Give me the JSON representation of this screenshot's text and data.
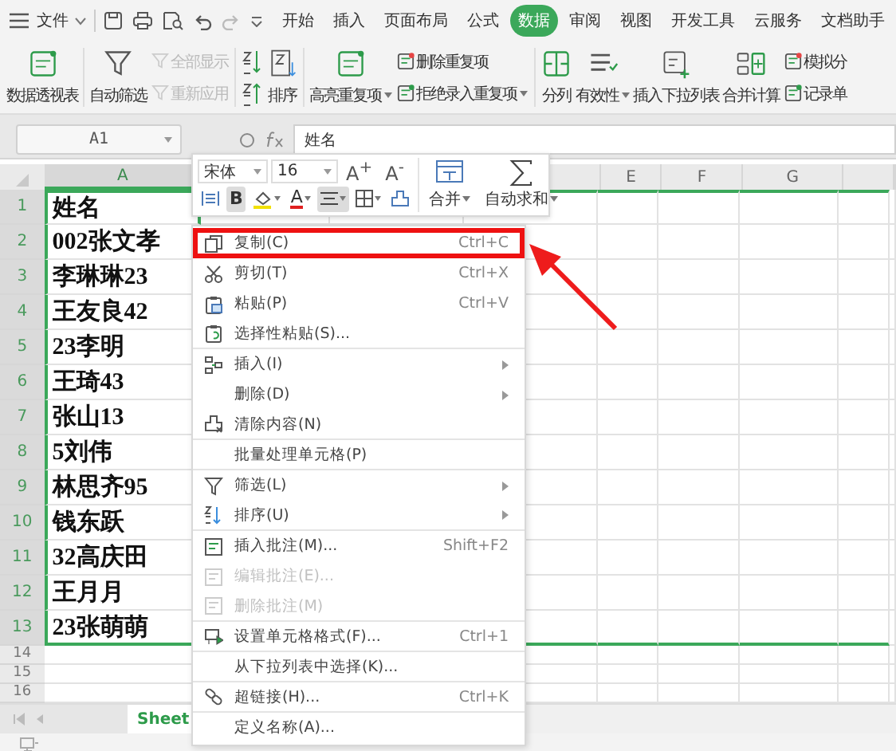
{
  "menu_bar": {
    "file_label": "文件",
    "tabs": [
      {
        "label": "开始",
        "selected": false
      },
      {
        "label": "插入",
        "selected": false
      },
      {
        "label": "页面布局",
        "selected": false
      },
      {
        "label": "公式",
        "selected": false
      },
      {
        "label": "数据",
        "selected": true
      },
      {
        "label": "审阅",
        "selected": false
      },
      {
        "label": "视图",
        "selected": false
      },
      {
        "label": "开发工具",
        "selected": false
      },
      {
        "label": "云服务",
        "selected": false
      },
      {
        "label": "文档助手",
        "selected": false
      }
    ]
  },
  "ribbon": {
    "columns": [
      {
        "kind": "large",
        "label": "数据透视表",
        "dropdown": false
      },
      {
        "kind": "separator"
      },
      {
        "kind": "large",
        "label": "自动筛选",
        "dropdown": false
      },
      {
        "kind": "stack",
        "items": [
          {
            "label": "全部显示",
            "disabled": true,
            "dropdown": false
          },
          {
            "label": "重新应用",
            "disabled": true,
            "dropdown": false
          }
        ]
      },
      {
        "kind": "separator"
      },
      {
        "kind": "sort-icons"
      },
      {
        "kind": "large",
        "label": "排序",
        "dropdown": false
      },
      {
        "kind": "separator"
      },
      {
        "kind": "large",
        "label": "高亮重复项",
        "dropdown": true
      },
      {
        "kind": "stack",
        "items": [
          {
            "label": "删除重复项",
            "disabled": false,
            "dropdown": false
          },
          {
            "label": "拒绝录入重复项",
            "disabled": false,
            "dropdown": true
          }
        ]
      },
      {
        "kind": "separator"
      },
      {
        "kind": "large",
        "label": "分列",
        "dropdown": false
      },
      {
        "kind": "large",
        "label": "有效性",
        "dropdown": true
      },
      {
        "kind": "large",
        "label": "插入下拉列表",
        "dropdown": false
      },
      {
        "kind": "large",
        "label": "合并计算",
        "dropdown": false
      },
      {
        "kind": "stack",
        "items": [
          {
            "label": "模拟分",
            "disabled": false,
            "dropdown": false
          },
          {
            "label": "记录单",
            "disabled": false,
            "dropdown": false
          }
        ]
      }
    ]
  },
  "formula_bar": {
    "name_box": "A1",
    "formula": "姓名"
  },
  "sheet": {
    "column_headers": [
      {
        "label": "A",
        "selected": true
      },
      {
        "label": "E",
        "selected": false
      },
      {
        "label": "F",
        "selected": false
      },
      {
        "label": "G",
        "selected": false
      }
    ],
    "rows": [
      {
        "number": "1",
        "value": "姓名",
        "selected": true
      },
      {
        "number": "2",
        "value": "002张文孝",
        "selected": true
      },
      {
        "number": "3",
        "value": "李琳琳23",
        "selected": true
      },
      {
        "number": "4",
        "value": "王友良42",
        "selected": true
      },
      {
        "number": "5",
        "value": "23李明",
        "selected": true
      },
      {
        "number": "6",
        "value": "王琦43",
        "selected": true
      },
      {
        "number": "7",
        "value": "张山13",
        "selected": true
      },
      {
        "number": "8",
        "value": "5刘伟",
        "selected": true
      },
      {
        "number": "9",
        "value": "林思齐95",
        "selected": true
      },
      {
        "number": "10",
        "value": "钱东跃",
        "selected": true
      },
      {
        "number": "11",
        "value": "32高庆田",
        "selected": true
      },
      {
        "number": "12",
        "value": "王月月",
        "selected": true
      },
      {
        "number": "13",
        "value": "23张萌萌",
        "selected": true
      },
      {
        "number": "14",
        "selected": false
      },
      {
        "number": "15",
        "selected": false
      },
      {
        "number": "16",
        "selected": false
      }
    ]
  },
  "sheet_tabs": [
    {
      "label": "Sheet",
      "selected": true
    }
  ],
  "mini_toolbar": {
    "font": "宋体",
    "size": "16",
    "size_buttons": [
      "A$^{+}$",
      "A$^{-}$"
    ],
    "format_buttons": [
      {
        "kind": "wrap",
        "selected": false,
        "dropdown": false
      },
      {
        "kind": "bold",
        "label": "B",
        "selected": true,
        "dropdown": false
      },
      {
        "kind": "fill",
        "selected": false,
        "dropdown": true
      },
      {
        "kind": "font-color",
        "label": "A",
        "selected": false,
        "dropdown": true
      },
      {
        "kind": "align",
        "selected": true,
        "dropdown": true
      },
      {
        "kind": "border",
        "selected": false,
        "dropdown": true
      },
      {
        "kind": "eraser",
        "selected": false,
        "dropdown": false
      }
    ],
    "large_buttons": [
      {
        "kind": "merge",
        "label": "合并",
        "dropdown": true
      },
      {
        "kind": "sum",
        "label": "自动求和",
        "dropdown": true
      }
    ]
  },
  "context_menu": {
    "items": [
      {
        "label": "复制(C)",
        "shortcut": "Ctrl+C",
        "submenu": false,
        "disabled": false,
        "divider_after": false,
        "annotated": true
      },
      {
        "label": "剪切(T)",
        "shortcut": "Ctrl+X",
        "submenu": false,
        "disabled": false,
        "divider_after": false,
        "annotated": false
      },
      {
        "label": "粘贴(P)",
        "shortcut": "Ctrl+V",
        "submenu": false,
        "disabled": false,
        "divider_after": false,
        "annotated": false
      },
      {
        "label": "选择性粘贴(S)...",
        "submenu": false,
        "disabled": false,
        "divider_after": true,
        "annotated": false
      },
      {
        "label": "插入(I)",
        "submenu": true,
        "disabled": false,
        "divider_after": false,
        "annotated": false
      },
      {
        "label": "删除(D)",
        "submenu": true,
        "disabled": false,
        "divider_after": false,
        "annotated": false
      },
      {
        "label": "清除内容(N)",
        "submenu": false,
        "disabled": false,
        "divider_after": true,
        "annotated": false
      },
      {
        "label": "批量处理单元格(P)",
        "submenu": false,
        "disabled": false,
        "divider_after": true,
        "annotated": false
      },
      {
        "label": "筛选(L)",
        "submenu": true,
        "disabled": false,
        "divider_after": false,
        "annotated": false
      },
      {
        "label": "排序(U)",
        "submenu": true,
        "disabled": false,
        "divider_after": true,
        "annotated": false
      },
      {
        "label": "插入批注(M)...",
        "shortcut": "Shift+F2",
        "submenu": false,
        "disabled": false,
        "divider_after": false,
        "annotated": false
      },
      {
        "label": "编辑批注(E)...",
        "submenu": false,
        "disabled": true,
        "divider_after": false,
        "annotated": false
      },
      {
        "label": "删除批注(M)",
        "submenu": false,
        "disabled": true,
        "divider_after": true,
        "annotated": false
      },
      {
        "label": "设置单元格格式(F)...",
        "shortcut": "Ctrl+1",
        "submenu": false,
        "disabled": false,
        "divider_after": true,
        "annotated": false
      },
      {
        "label": "从下拉列表中选择(K)...",
        "submenu": false,
        "disabled": false,
        "divider_after": true,
        "annotated": false
      },
      {
        "label": "超链接(H)...",
        "shortcut": "Ctrl+K",
        "submenu": false,
        "disabled": false,
        "divider_after": true,
        "annotated": false
      },
      {
        "label": "定义名称(A)...",
        "submenu": false,
        "disabled": false,
        "divider_after": false,
        "annotated": false
      }
    ]
  }
}
